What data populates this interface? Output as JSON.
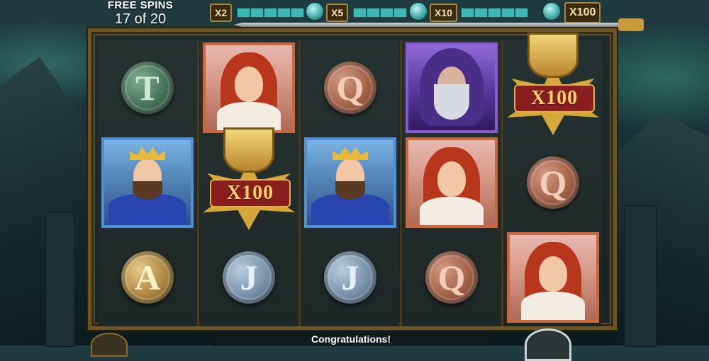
{
  "free_spins": {
    "title": "FREE SPINS",
    "count": "17 of 20"
  },
  "multipliers": [
    "X2",
    "X5",
    "X10",
    "X100"
  ],
  "status": {
    "message": "Congratulations!"
  },
  "reels": [
    [
      {
        "type": "coin",
        "letter": "T",
        "color": "green"
      },
      {
        "type": "card",
        "character": "king"
      },
      {
        "type": "coin",
        "letter": "A",
        "color": "gold"
      }
    ],
    [
      {
        "type": "card",
        "character": "lady"
      },
      {
        "type": "multiplier",
        "label": "X100"
      },
      {
        "type": "coin",
        "letter": "J",
        "color": "steel"
      }
    ],
    [
      {
        "type": "coin",
        "letter": "Q",
        "color": "copper"
      },
      {
        "type": "card",
        "character": "king"
      },
      {
        "type": "coin",
        "letter": "J",
        "color": "steel"
      }
    ],
    [
      {
        "type": "card",
        "character": "wizard"
      },
      {
        "type": "card",
        "character": "lady"
      },
      {
        "type": "coin",
        "letter": "Q",
        "color": "copper"
      }
    ],
    [
      {
        "type": "multiplier",
        "label": "X100"
      },
      {
        "type": "coin",
        "letter": "Q",
        "color": "copper"
      },
      {
        "type": "card",
        "character": "lady"
      }
    ]
  ]
}
